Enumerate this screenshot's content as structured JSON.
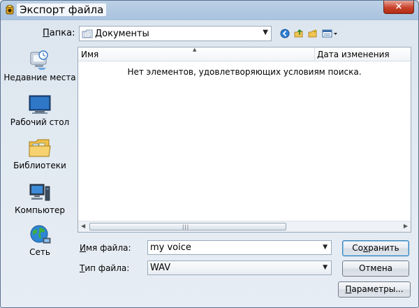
{
  "window": {
    "title": "Экспорт файла",
    "close_symbol": "×"
  },
  "look_in": {
    "label": "Папка:",
    "label_access_key": "П",
    "label_rest": "апка:",
    "value": "Документы"
  },
  "places": [
    {
      "label": "Недавние места",
      "icon": "recent-places-icon"
    },
    {
      "label": "Рабочий стол",
      "icon": "desktop-icon"
    },
    {
      "label": "Библиотеки",
      "icon": "libraries-icon"
    },
    {
      "label": "Компьютер",
      "icon": "computer-icon"
    },
    {
      "label": "Сеть",
      "icon": "network-icon"
    }
  ],
  "file_list": {
    "columns": [
      "Имя",
      "Дата изменения"
    ],
    "empty_message": "Нет элементов, удовлетворяющих условиям поиска."
  },
  "file_name": {
    "label_access_key": "И",
    "label_rest": "мя файла:",
    "value": "my voice"
  },
  "file_type": {
    "label_access_key": "Т",
    "label_rest": "ип файла:",
    "value": "WAV"
  },
  "buttons": {
    "save_pre": "Со",
    "save_key": "х",
    "save_post": "ранить",
    "cancel": "Отмена",
    "options_key": "П",
    "options_rest": "араметры..."
  },
  "colors": {
    "title_gradient_top": "#bcd0e6",
    "close_red": "#c8412b",
    "default_button_border": "#3c7fb1"
  }
}
